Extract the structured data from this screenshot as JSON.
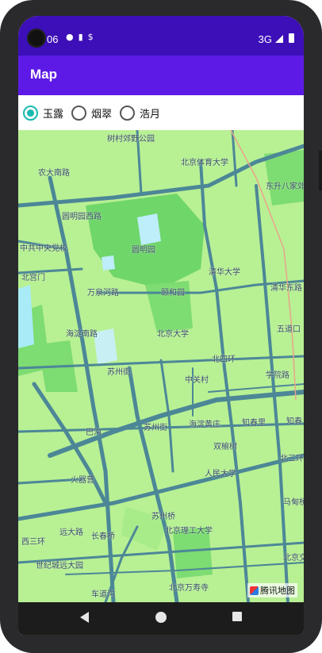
{
  "status_bar": {
    "time": "06",
    "network": "3G"
  },
  "app_bar": {
    "title": "Map"
  },
  "map_styles": [
    {
      "label": "玉露",
      "checked": true
    },
    {
      "label": "烟翠",
      "checked": false
    },
    {
      "label": "浩月",
      "checked": false
    }
  ],
  "map_labels": {
    "l1": "树村郊野公园",
    "l2": "北京体育大学",
    "l3": "农大南路",
    "l4": "东升八家郊野公园",
    "l5": "圆明园西路",
    "l6": "中共中央党校",
    "l7": "圆明园",
    "l8": "北宫门",
    "l9": "清华大学",
    "l10": "清华东路",
    "l11": "颐和园",
    "l12": "万泉河路",
    "l13": "海淀南路",
    "l14": "北京大学",
    "l15": "五道口",
    "l16": "苏州街",
    "l17": "北四环",
    "l18": "中关村",
    "l19": "学院路",
    "l20": "巴沟",
    "l21": "苏州街",
    "l22": "海淀黄庄",
    "l23": "知春里",
    "l24": "知春",
    "l25": "双榆树",
    "l26": "北三环",
    "l27": "人民大学",
    "l28": "火器营",
    "l29": "长春桥",
    "l30": "苏州桥",
    "l31": "北京理工大学",
    "l32": "远大路",
    "l33": "世纪城远大园",
    "l34": "北京万寿寺",
    "l35": "车道沟",
    "l36": "西三环",
    "l37": "北京交通大学",
    "l38": "马甸桥"
  },
  "attribution": "腾讯地图",
  "colors": {
    "status": "#3c0fb8",
    "appbar": "#5d1ae6",
    "accent": "#19b9b0",
    "land": "#b8f094",
    "road": "#4a8a9a"
  }
}
